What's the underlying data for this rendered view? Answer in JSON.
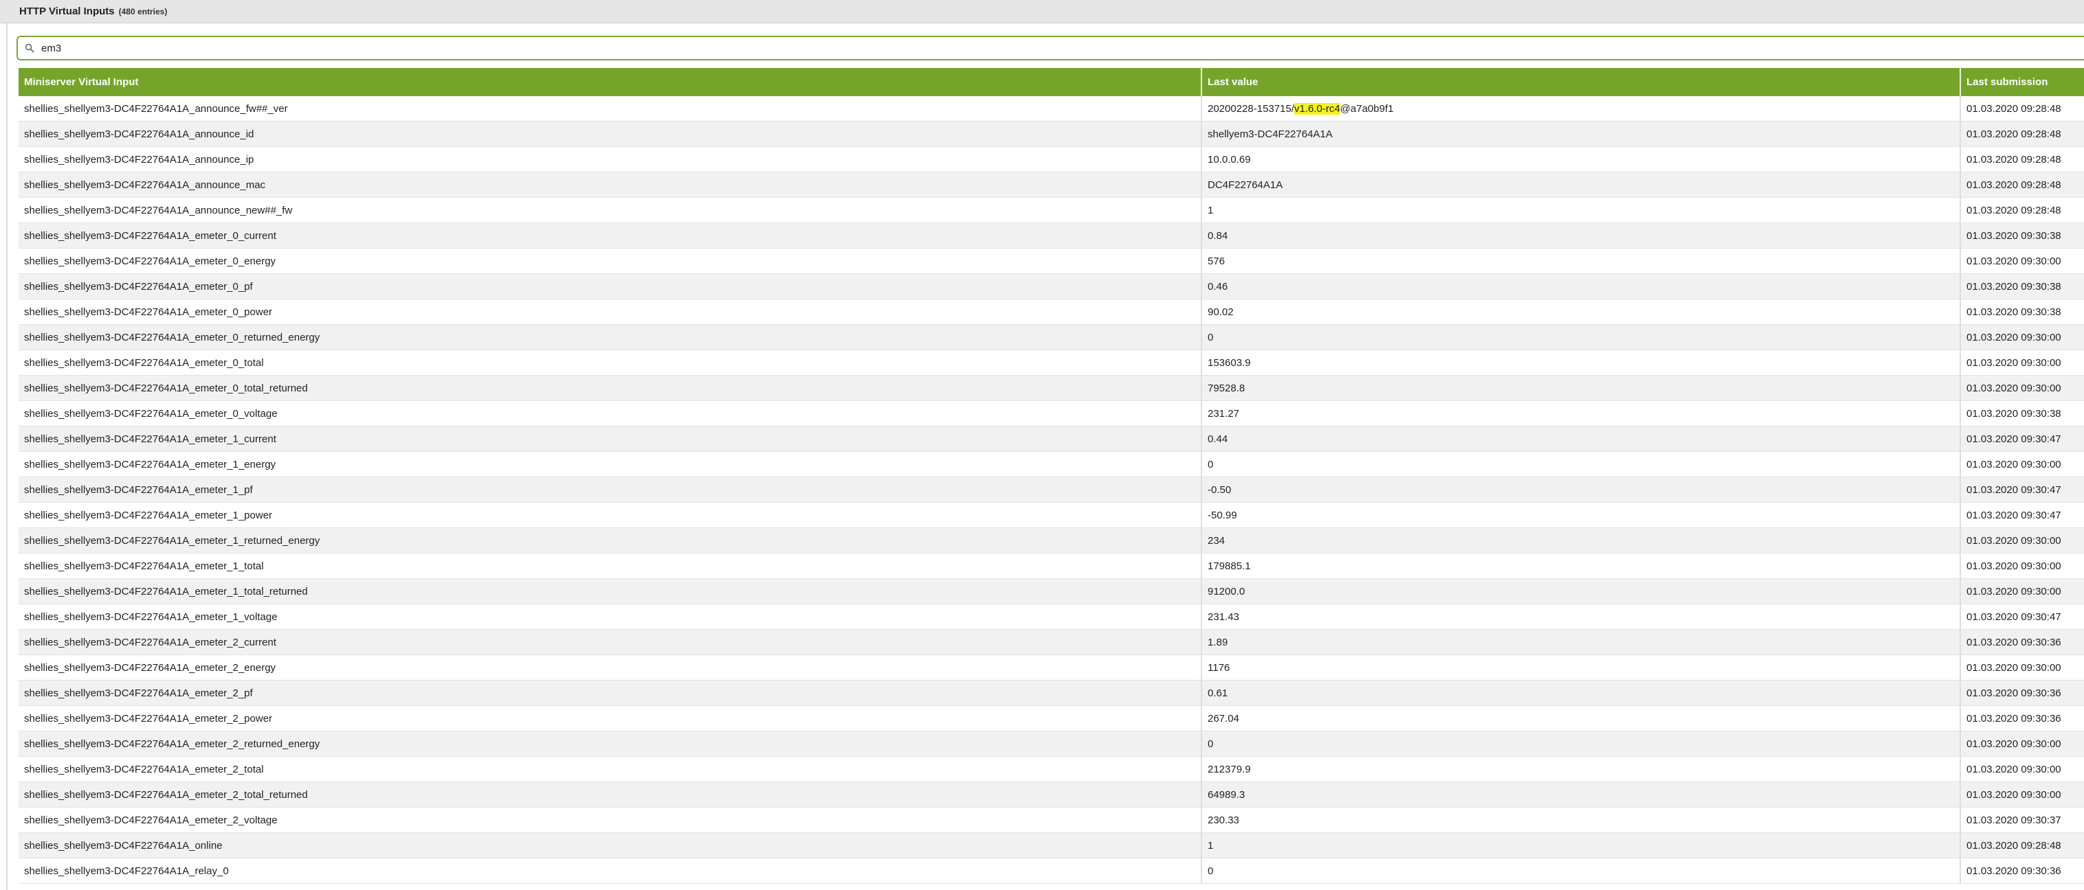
{
  "header": {
    "title": "HTTP Virtual Inputs",
    "entry_count": "(480 entries)"
  },
  "search": {
    "value": "em3",
    "icon": "search-icon"
  },
  "table": {
    "columns": [
      "Miniserver Virtual Input",
      "Last value",
      "Last submission"
    ],
    "rows": [
      {
        "name": "shellies_shellyem3-DC4F22764A1A_announce_fw##_ver",
        "value": "20200228-153715/v1.6.0-rc4@a7a0b9f1",
        "time": "01.03.2020 09:28:48"
      },
      {
        "name": "shellies_shellyem3-DC4F22764A1A_announce_id",
        "value": "shellyem3-DC4F22764A1A",
        "time": "01.03.2020 09:28:48"
      },
      {
        "name": "shellies_shellyem3-DC4F22764A1A_announce_ip",
        "value": "10.0.0.69",
        "time": "01.03.2020 09:28:48"
      },
      {
        "name": "shellies_shellyem3-DC4F22764A1A_announce_mac",
        "value": "DC4F22764A1A",
        "time": "01.03.2020 09:28:48"
      },
      {
        "name": "shellies_shellyem3-DC4F22764A1A_announce_new##_fw",
        "value": "1",
        "time": "01.03.2020 09:28:48"
      },
      {
        "name": "shellies_shellyem3-DC4F22764A1A_emeter_0_current",
        "value": "0.84",
        "time": "01.03.2020 09:30:38"
      },
      {
        "name": "shellies_shellyem3-DC4F22764A1A_emeter_0_energy",
        "value": "576",
        "time": "01.03.2020 09:30:00"
      },
      {
        "name": "shellies_shellyem3-DC4F22764A1A_emeter_0_pf",
        "value": "0.46",
        "time": "01.03.2020 09:30:38"
      },
      {
        "name": "shellies_shellyem3-DC4F22764A1A_emeter_0_power",
        "value": "90.02",
        "time": "01.03.2020 09:30:38"
      },
      {
        "name": "shellies_shellyem3-DC4F22764A1A_emeter_0_returned_energy",
        "value": "0",
        "time": "01.03.2020 09:30:00"
      },
      {
        "name": "shellies_shellyem3-DC4F22764A1A_emeter_0_total",
        "value": "153603.9",
        "time": "01.03.2020 09:30:00"
      },
      {
        "name": "shellies_shellyem3-DC4F22764A1A_emeter_0_total_returned",
        "value": "79528.8",
        "time": "01.03.2020 09:30:00"
      },
      {
        "name": "shellies_shellyem3-DC4F22764A1A_emeter_0_voltage",
        "value": "231.27",
        "time": "01.03.2020 09:30:38"
      },
      {
        "name": "shellies_shellyem3-DC4F22764A1A_emeter_1_current",
        "value": "0.44",
        "time": "01.03.2020 09:30:47"
      },
      {
        "name": "shellies_shellyem3-DC4F22764A1A_emeter_1_energy",
        "value": "0",
        "time": "01.03.2020 09:30:00"
      },
      {
        "name": "shellies_shellyem3-DC4F22764A1A_emeter_1_pf",
        "value": "-0.50",
        "time": "01.03.2020 09:30:47"
      },
      {
        "name": "shellies_shellyem3-DC4F22764A1A_emeter_1_power",
        "value": "-50.99",
        "time": "01.03.2020 09:30:47"
      },
      {
        "name": "shellies_shellyem3-DC4F22764A1A_emeter_1_returned_energy",
        "value": "234",
        "time": "01.03.2020 09:30:00"
      },
      {
        "name": "shellies_shellyem3-DC4F22764A1A_emeter_1_total",
        "value": "179885.1",
        "time": "01.03.2020 09:30:00"
      },
      {
        "name": "shellies_shellyem3-DC4F22764A1A_emeter_1_total_returned",
        "value": "91200.0",
        "time": "01.03.2020 09:30:00"
      },
      {
        "name": "shellies_shellyem3-DC4F22764A1A_emeter_1_voltage",
        "value": "231.43",
        "time": "01.03.2020 09:30:47"
      },
      {
        "name": "shellies_shellyem3-DC4F22764A1A_emeter_2_current",
        "value": "1.89",
        "time": "01.03.2020 09:30:36"
      },
      {
        "name": "shellies_shellyem3-DC4F22764A1A_emeter_2_energy",
        "value": "1176",
        "time": "01.03.2020 09:30:00"
      },
      {
        "name": "shellies_shellyem3-DC4F22764A1A_emeter_2_pf",
        "value": "0.61",
        "time": "01.03.2020 09:30:36"
      },
      {
        "name": "shellies_shellyem3-DC4F22764A1A_emeter_2_power",
        "value": "267.04",
        "time": "01.03.2020 09:30:36"
      },
      {
        "name": "shellies_shellyem3-DC4F22764A1A_emeter_2_returned_energy",
        "value": "0",
        "time": "01.03.2020 09:30:00"
      },
      {
        "name": "shellies_shellyem3-DC4F22764A1A_emeter_2_total",
        "value": "212379.9",
        "time": "01.03.2020 09:30:00"
      },
      {
        "name": "shellies_shellyem3-DC4F22764A1A_emeter_2_total_returned",
        "value": "64989.3",
        "time": "01.03.2020 09:30:00"
      },
      {
        "name": "shellies_shellyem3-DC4F22764A1A_emeter_2_voltage",
        "value": "230.33",
        "time": "01.03.2020 09:30:37"
      },
      {
        "name": "shellies_shellyem3-DC4F22764A1A_online",
        "value": "1",
        "time": "01.03.2020 09:28:48"
      },
      {
        "name": "shellies_shellyem3-DC4F22764A1A_relay_0",
        "value": "0",
        "time": "01.03.2020 09:30:36"
      }
    ]
  },
  "highlight": {
    "term": "v1.6.0-rc4",
    "color": "#f7f21e"
  },
  "colors": {
    "header_green": "#74a52a",
    "search_border": "#7aa83a",
    "titlebar_bg": "#e6e6e6"
  },
  "watermark": {
    "icon": "house-and-gear-watermark-icon"
  }
}
